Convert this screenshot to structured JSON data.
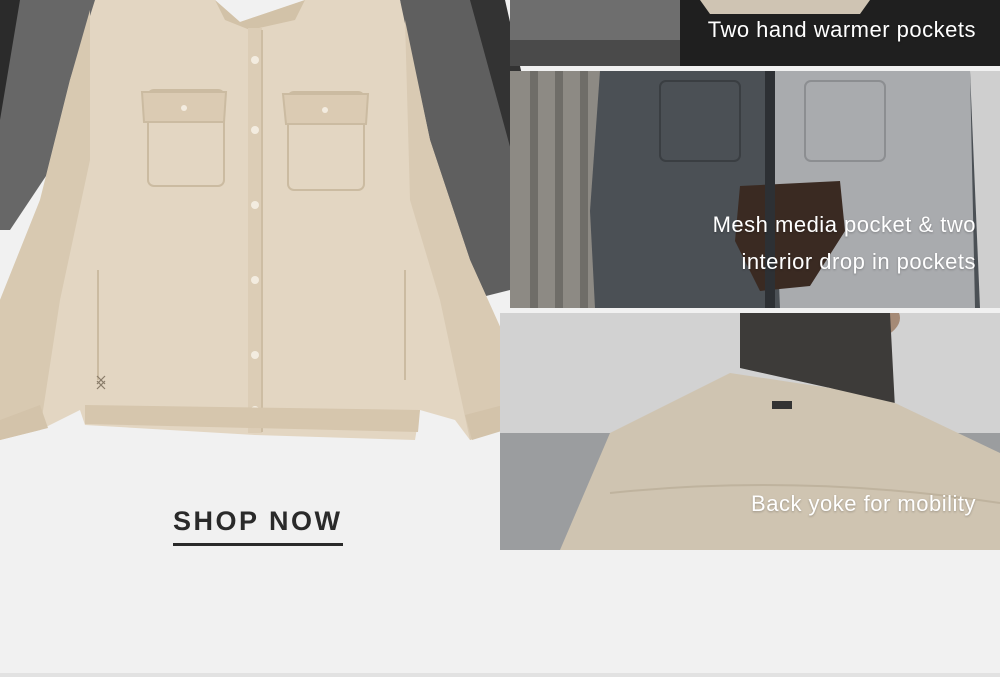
{
  "cta": {
    "shop_now_label": "SHOP NOW"
  },
  "features": [
    {
      "caption_lines": [
        "Two hand warmer pockets"
      ]
    },
    {
      "caption_lines": [
        "Mesh media pocket & two",
        "interior drop in pockets"
      ]
    },
    {
      "caption_lines": [
        "Back yoke for mobility"
      ]
    }
  ],
  "colors": {
    "background": "#f1f1f1",
    "text_dark": "#2a2a2a",
    "caption_text": "#ffffff",
    "jacket_tan": "#e0d2bd",
    "jacket_gray": "#6a6a6a",
    "jacket_charcoal": "#3a3a3a"
  }
}
